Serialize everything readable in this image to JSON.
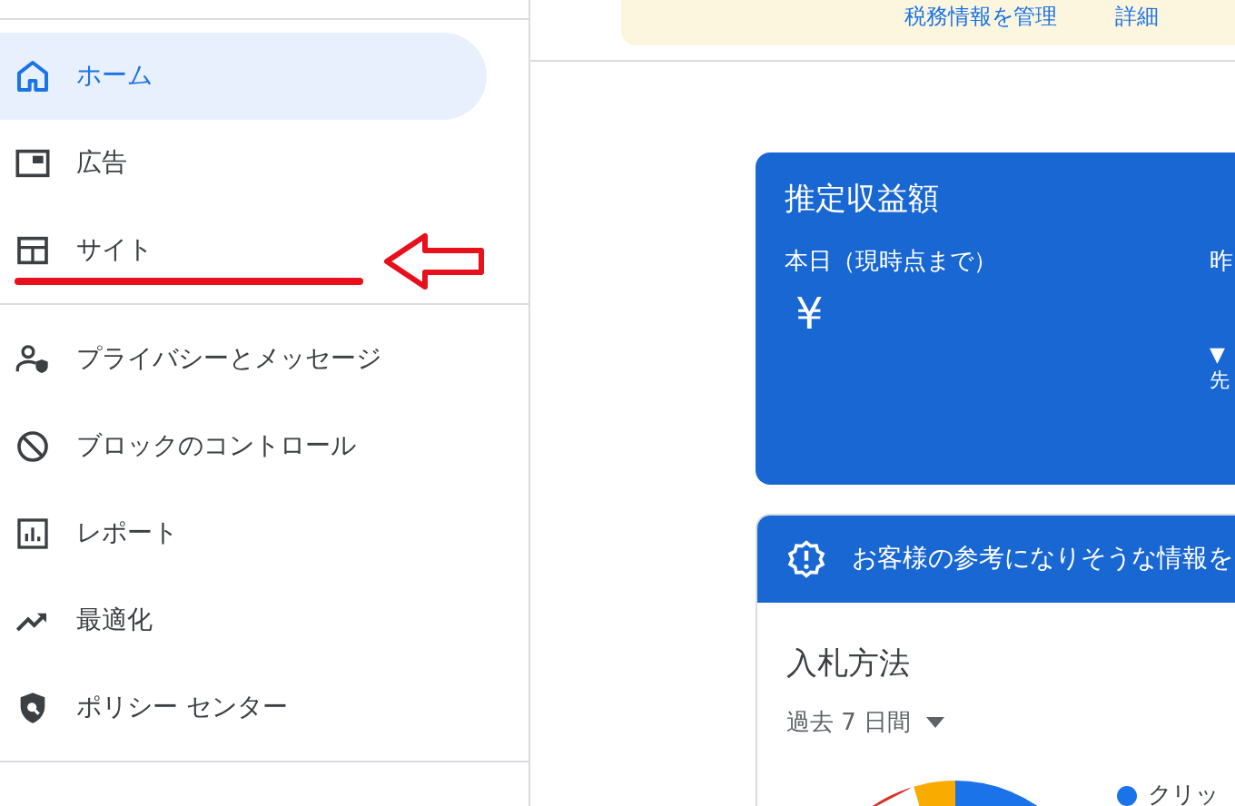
{
  "sidebar": {
    "items": [
      {
        "label": "ホーム",
        "selected": true
      },
      {
        "label": "広告",
        "selected": false
      },
      {
        "label": "サイト",
        "selected": false
      },
      {
        "label": "プライバシーとメッセージ",
        "selected": false
      },
      {
        "label": "ブロックのコントロール",
        "selected": false
      },
      {
        "label": "レポート",
        "selected": false
      },
      {
        "label": "最適化",
        "selected": false
      },
      {
        "label": "ポリシー センター",
        "selected": false
      }
    ]
  },
  "banner": {
    "links": [
      "税務情報を管理",
      "詳細"
    ]
  },
  "earnings_card": {
    "title": "推定収益額",
    "columns": [
      {
        "label": "本日（現時点まで）",
        "value": "¥"
      },
      {
        "label": "昨",
        "notes": [
          "▼",
          "先"
        ]
      }
    ]
  },
  "info_card": {
    "banner_text": "お客様の参考になりそうな情報を",
    "title": "入札方法",
    "period": "過去 7 日間",
    "legend": [
      {
        "label": "クリッ",
        "color": "#1a73e8"
      }
    ]
  }
}
